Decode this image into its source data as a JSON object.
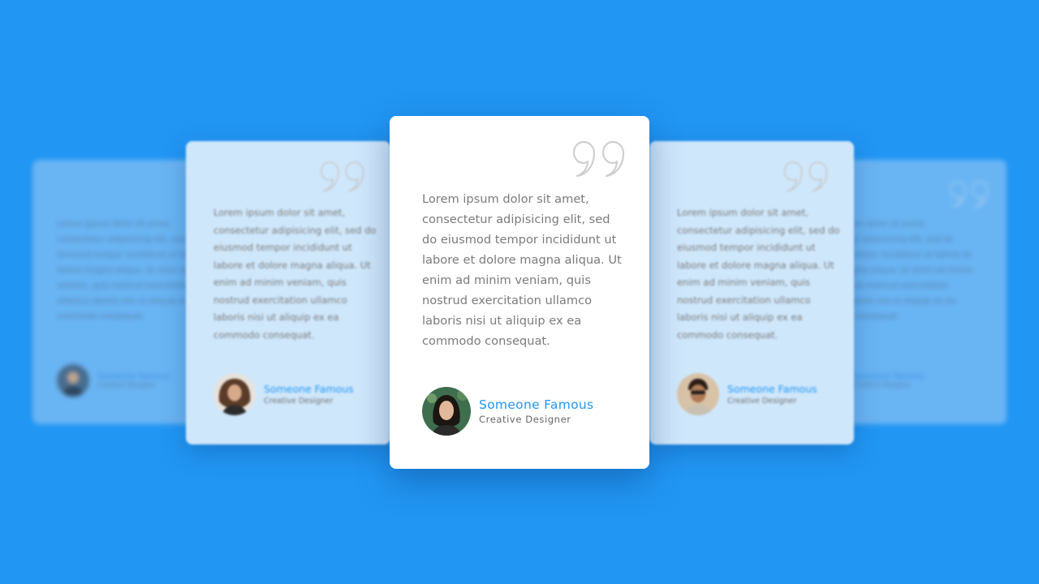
{
  "testimonials": [
    {
      "quote": "Lorem ipsum dolor sit amet, consectetur adipisicing elit, sed do eiusmod tempor incididunt ut labore et dolore magna aliqua. Ut enim ad minim veniam, quis nostrud exercitation ullamco laboris nisi ut aliquip ex ea commodo consequat.",
      "name": "Someone Famous",
      "role": "Creative Designer"
    },
    {
      "quote": "Lorem ipsum dolor sit amet, consectetur adipisicing elit, sed do eiusmod tempor incididunt ut labore et dolore magna aliqua. Ut enim ad minim veniam, quis nostrud exercitation ullamco laboris nisi ut aliquip ex ea commodo consequat.",
      "name": "Someone Famous",
      "role": "Creative Designer"
    },
    {
      "quote": "Lorem ipsum dolor sit amet, consectetur adipisicing elit, sed do eiusmod tempor incididunt ut labore et dolore magna aliqua. Ut enim ad minim veniam, quis nostrud exercitation ullamco laboris nisi ut aliquip ex ea commodo consequat.",
      "name": "Someone Famous",
      "role": "Creative Designer"
    },
    {
      "quote": "Lorem ipsum dolor sit amet, consectetur adipisicing elit, sed do eiusmod tempor incididunt ut labore et dolore magna aliqua. Ut enim ad minim veniam, quis nostrud exercitation ullamco laboris nisi ut aliquip ex ea commodo consequat.",
      "name": "Someone Famous",
      "role": "Creative Designer"
    },
    {
      "quote": "Lorem ipsum dolor sit amet, consectetur adipisicing elit, sed do eiusmod tempor incididunt ut labore et dolore magna aliqua. Ut enim ad minim veniam, quis nostrud exercitation ullamco laboris nisi ut aliquip ex ea commodo consequat.",
      "name": "Someone Famous",
      "role": "Creative Designer"
    }
  ],
  "icons": {
    "quote": "quote-icon",
    "avatar": "avatar"
  },
  "colors": {
    "background": "#2196f3",
    "accent": "#2196f3",
    "card": "#ffffff",
    "text": "#7b7b7b"
  }
}
